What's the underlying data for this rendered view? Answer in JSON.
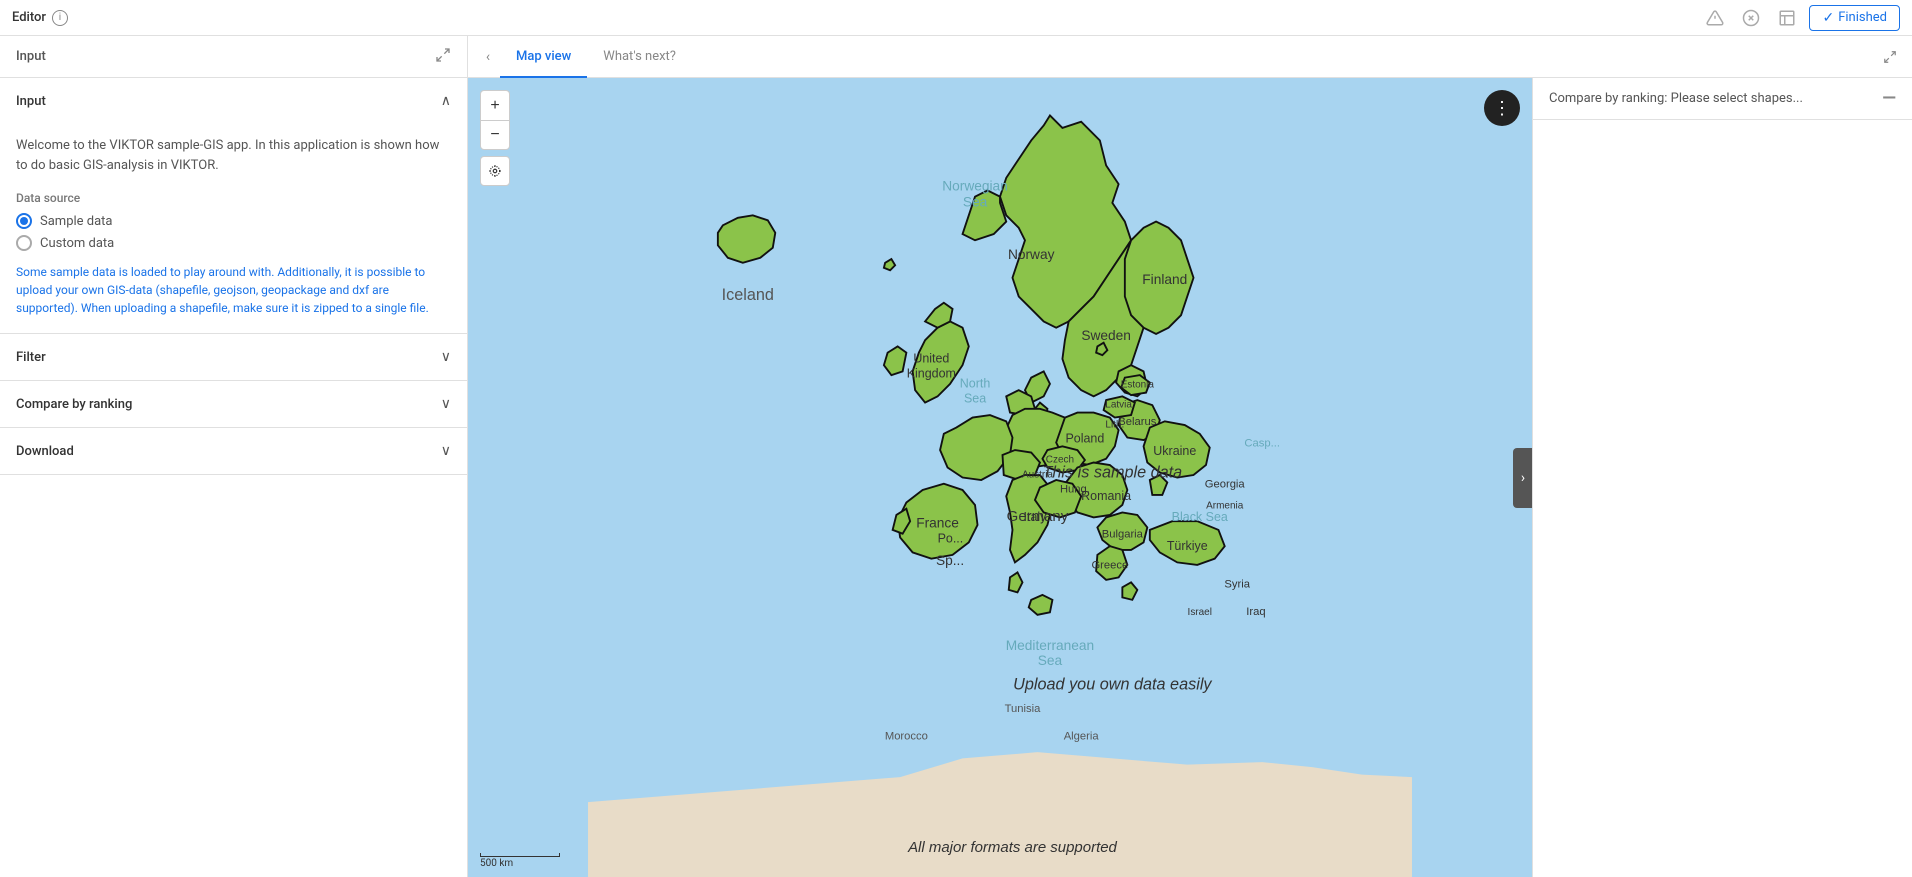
{
  "topbar": {
    "title": "Editor",
    "info_label": "i",
    "finished_label": "Finished",
    "icons": [
      "warning-icon",
      "close-icon",
      "window-icon"
    ]
  },
  "left_panel": {
    "header_title": "Input",
    "expand_label": "⛶",
    "sections": {
      "input": {
        "title": "Input",
        "welcome_text": "Welcome to the VIKTOR sample-GIS app. In this application is shown how to do basic GIS-analysis in VIKTOR.",
        "data_source_label": "Data source",
        "radio_options": [
          {
            "label": "Sample data",
            "selected": true
          },
          {
            "label": "Custom data",
            "selected": false
          }
        ],
        "info_text": "Some sample data is loaded to play around with. Additionally, it is possible to upload your own GIS-data (shapefile, geojson, geopackage and dxf are supported). When uploading a shapefile, make sure it is zipped to a single file."
      },
      "filter": {
        "title": "Filter"
      },
      "compare_by_ranking": {
        "title": "Compare by ranking"
      },
      "download": {
        "title": "Download"
      }
    }
  },
  "tabs": {
    "map_view": "Map view",
    "whats_next": "What's next?"
  },
  "map": {
    "sample_data_label": "This is sample data",
    "upload_label": "Upload you own data easily",
    "all_formats_label": "All major formats are supported",
    "iceland_label": "Iceland",
    "norwegian_sea_label": "Norwegian Sea",
    "north_sea_label": "North Sea",
    "mediterranean_sea_label": "Mediterranean Sea",
    "scale_label": "500 km",
    "controls": {
      "zoom_in": "+",
      "zoom_out": "−",
      "locate": "⊙"
    }
  },
  "compare_panel": {
    "title": "Compare by ranking: Please select shapes...",
    "collapse_icon": "—"
  }
}
